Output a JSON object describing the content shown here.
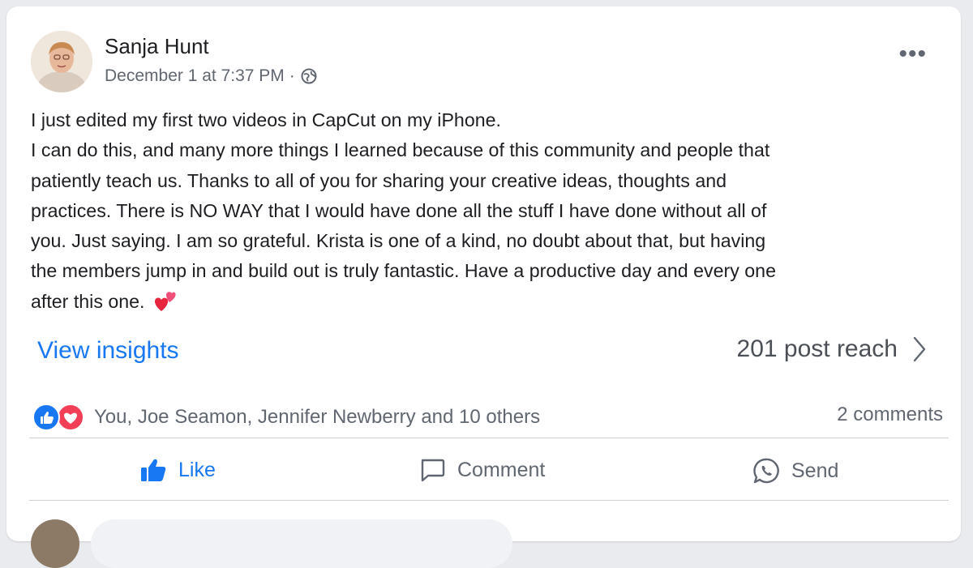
{
  "post": {
    "author": "Sanja Hunt",
    "timestamp": "December 1 at 7:37 PM",
    "separator": "·",
    "audience_icon": "globe-icon",
    "more_label": "•••",
    "body_lines": [
      "I just edited my first two videos in CapCut on my iPhone.",
      "I can do this, and many more things I learned because of this community and people that",
      "patiently teach us.  Thanks to all of you for sharing your creative ideas, thoughts and",
      "practices. There is NO WAY that I would have done all the stuff I have done without all of",
      "you. Just saying.  I am so grateful.  Krista is one of a kind, no doubt about that, but having",
      "the members jump in and build out is truly fantastic.  Have a productive day and every one",
      "after this one."
    ],
    "trailing_emoji": "two-hearts-emoji"
  },
  "insights": {
    "view_label": "View insights",
    "reach_label": "201 post reach"
  },
  "reactions": {
    "icons": [
      "like-reaction-icon",
      "love-reaction-icon"
    ],
    "names": "You, Joe Seamon, Jennifer Newberry and 10 others",
    "comments": "2 comments"
  },
  "actions": {
    "like": "Like",
    "comment": "Comment",
    "send": "Send"
  },
  "colors": {
    "accent": "#1877f2",
    "love": "#f33e58",
    "text": "#1c1e21",
    "secondary": "#606770"
  }
}
